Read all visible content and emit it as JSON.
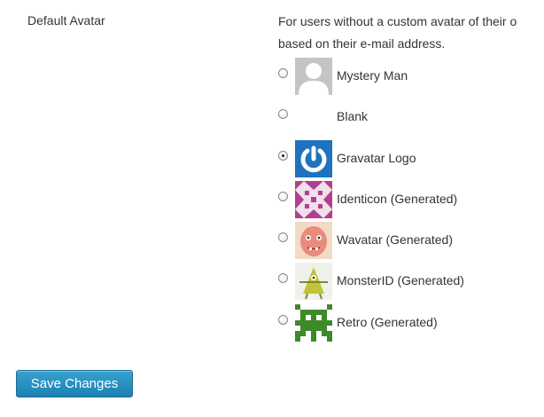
{
  "setting": {
    "label": "Default Avatar",
    "description_line1": "For users without a custom avatar of their o",
    "description_line2": "based on their e-mail address."
  },
  "avatar_options": [
    {
      "label": "Mystery Man",
      "checked": false,
      "icon": "mystery-man-avatar"
    },
    {
      "label": "Blank",
      "checked": false,
      "icon": "blank-avatar"
    },
    {
      "label": "Gravatar Logo",
      "checked": true,
      "icon": "gravatar-logo-avatar"
    },
    {
      "label": "Identicon (Generated)",
      "checked": false,
      "icon": "identicon-avatar"
    },
    {
      "label": "Wavatar (Generated)",
      "checked": false,
      "icon": "wavatar-avatar"
    },
    {
      "label": "MonsterID (Generated)",
      "checked": false,
      "icon": "monsterid-avatar"
    },
    {
      "label": "Retro (Generated)",
      "checked": false,
      "icon": "retro-avatar"
    }
  ],
  "save_button": {
    "label": "Save Changes",
    "color": "#2a8fc2"
  }
}
